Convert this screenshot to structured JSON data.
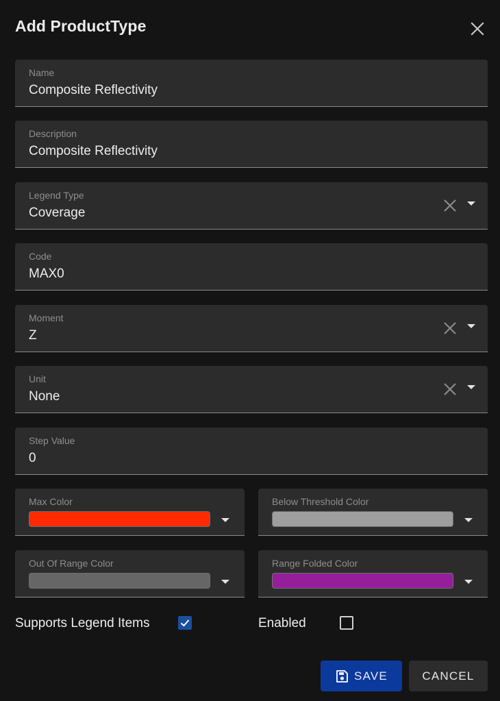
{
  "dialog": {
    "title": "Add ProductType"
  },
  "fields": {
    "name": {
      "label": "Name",
      "value": "Composite Reflectivity"
    },
    "description": {
      "label": "Description",
      "value": "Composite Reflectivity"
    },
    "legend_type": {
      "label": "Legend Type",
      "value": "Coverage"
    },
    "code": {
      "label": "Code",
      "value": "MAX0"
    },
    "moment": {
      "label": "Moment",
      "value": "Z"
    },
    "unit": {
      "label": "Unit",
      "value": "None"
    },
    "step_value": {
      "label": "Step Value",
      "value": "0"
    }
  },
  "colors": {
    "max_color": {
      "label": "Max Color",
      "value": "#ff2a00"
    },
    "below_threshold_color": {
      "label": "Below Threshold Color",
      "value": "#9e9e9e"
    },
    "out_of_range_color": {
      "label": "Out Of Range Color",
      "value": "#666666"
    },
    "range_folded_color": {
      "label": "Range Folded Color",
      "value": "#951e9a"
    }
  },
  "checkboxes": {
    "supports_legend_items": {
      "label": "Supports Legend Items",
      "checked": true
    },
    "enabled": {
      "label": "Enabled",
      "checked": false
    }
  },
  "actions": {
    "save_label": "SAVE",
    "cancel_label": "CANCEL"
  },
  "theme": {
    "primary": "#0b3a9c",
    "background": "#141414",
    "field_background": "#2c2c2c"
  },
  "icons": {
    "close": "close-icon",
    "clear": "clear-icon",
    "dropdown": "chevron-down-icon",
    "save": "save-icon",
    "check": "check-icon"
  }
}
